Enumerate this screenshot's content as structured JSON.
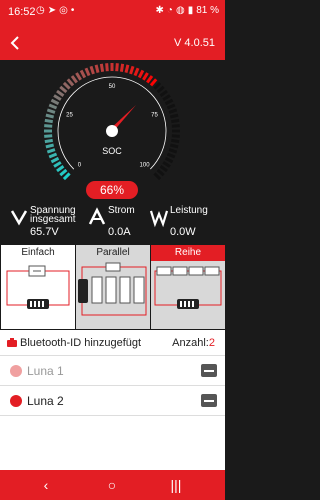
{
  "status_bar": {
    "time": "16:52",
    "left_icons": [
      "signal-icon",
      "telegram-icon",
      "whatsapp-icon",
      "dot-icon"
    ],
    "right_icons": [
      "bluetooth-icon",
      "network-icon",
      "wifi-icon",
      "battery-icon"
    ],
    "battery": "81 %"
  },
  "header": {
    "version": "V 4.0.51"
  },
  "gauge": {
    "center_label": "SOC",
    "tick_labels": [
      "0",
      "25",
      "50",
      "75",
      "100"
    ],
    "soc_value": "66%",
    "soc_fraction": 0.66
  },
  "stats": [
    {
      "label": "Spannung insgesamt",
      "value": "65.7V",
      "icon": "voltage-icon"
    },
    {
      "label": "Strom",
      "value": "0.0A",
      "icon": "current-icon"
    },
    {
      "label": "Leistung",
      "value": "0.0W",
      "icon": "power-icon"
    }
  ],
  "modes": [
    {
      "label": "Einfach",
      "active": true
    },
    {
      "label": "Parallel",
      "active": false
    },
    {
      "label": "Reihe",
      "active": false
    }
  ],
  "bluetooth": {
    "label": "Bluetooth-ID hinzugefügt",
    "count_label": "Anzahl:",
    "count": "2"
  },
  "devices": [
    {
      "name": "Luna 1",
      "connected": false
    },
    {
      "name": "Luna 2",
      "connected": true
    }
  ],
  "colors": {
    "accent": "#e31e24",
    "gauge_start": "#1ecfc9",
    "gauge_end": "#ff0000"
  }
}
